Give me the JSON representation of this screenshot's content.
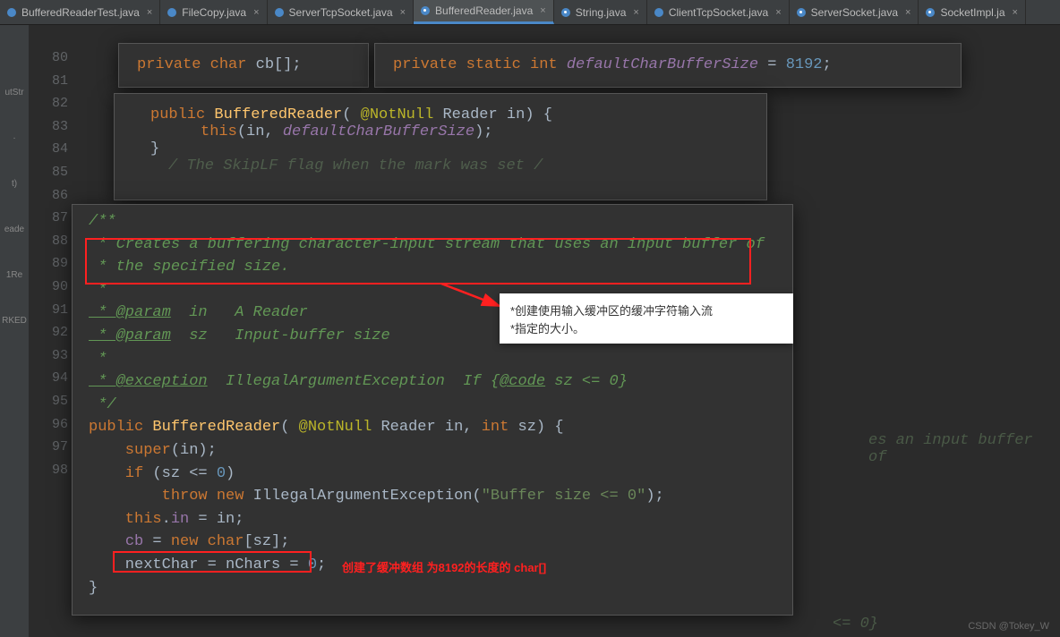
{
  "tabs": [
    {
      "label": "BufferedReaderTest.java",
      "icon": "java"
    },
    {
      "label": "FileCopy.java",
      "icon": "class"
    },
    {
      "label": "ServerTcpSocket.java",
      "icon": "class"
    },
    {
      "label": "BufferedReader.java",
      "icon": "lock",
      "active": true
    },
    {
      "label": "String.java",
      "icon": "lock"
    },
    {
      "label": "ClientTcpSocket.java",
      "icon": "class"
    },
    {
      "label": "ServerSocket.java",
      "icon": "lock"
    },
    {
      "label": "SocketImpl.ja",
      "icon": "lock"
    }
  ],
  "lineStart": 80,
  "lineEnd": 98,
  "sidebar": [
    "utStr",
    "·",
    "t)",
    "eade",
    "1Re",
    "RKED"
  ],
  "snippet1": {
    "kw": "private char",
    "var": "cb[];"
  },
  "snippet2": {
    "kw": "private static int",
    "var": "defaultCharBufferSize",
    "eq": " = ",
    "val": "8192",
    ";": ";"
  },
  "constructor1": {
    "kw": "public",
    "name": "BufferedReader",
    "ann": "@NotNull",
    "arg": "Reader in",
    "open": " {",
    "body_kw": "this",
    "body_args": "(in, ",
    "body_it": "defaultCharBufferSize",
    "body_close": ");",
    "close": "}"
  },
  "faint_line": "The SkipLF flag when the mark was set",
  "javadoc": {
    "start": "/**",
    "l1": " * Creates a buffering character-input stream that uses an input buffer of",
    "l2": " * the specified size.",
    "blank": " *",
    "param1": " * @param",
    "param1_n": "  in   A Reader",
    "param2": " * @param",
    "param2_n": "  sz   Input-buffer size",
    "exc": " * @exception",
    "exc_n": "  IllegalArgumentException  If {",
    "exc_code": "@code",
    "exc_tail": " sz <= 0}",
    "end": " */"
  },
  "code": {
    "sig_kw": "public ",
    "sig_name": "BufferedReader",
    "sig_open": "( ",
    "sig_ann": "@NotNull",
    "sig_args": " Reader in, ",
    "sig_int": "int",
    "sig_sz": " sz) {",
    "l1": "    super(in);",
    "l2a": "    if (sz <= ",
    "l2b": "0",
    "l2c": ")",
    "l3a": "        throw new ",
    "l3b": "IllegalArgumentException(",
    "l3c": "\"Buffer size <= 0\"",
    "l3d": ");",
    "l4a": "    this.",
    "l4b": "in",
    "l4c": " = in;",
    "l5a": "    ",
    "l5b": "cb",
    "l5c": " = ",
    "l5d": "new char",
    "l5e": "[sz];",
    "l6a": "    nextChar = nChars = ",
    "l6b": "0",
    "l6c": ";",
    "l7": "}"
  },
  "tooltip": {
    "line1": "*创建使用输入缓冲区的缓冲字符输入流",
    "line2": "*指定的大小。"
  },
  "red_text": "创建了缓冲数组  为8192的长度的 char[]",
  "faint1": "es an input buffer of",
  "faint2": "<= 0}",
  "watermark": "CSDN @Tokey_W"
}
